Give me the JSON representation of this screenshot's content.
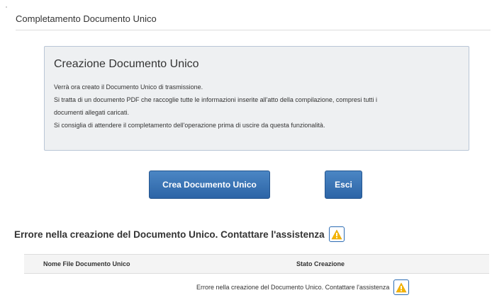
{
  "header": {
    "title": "Completamento Documento Unico"
  },
  "info_panel": {
    "title": "Creazione Documento Unico",
    "lines": [
      "Verrà ora creato il Documento Unico di trasmissione.",
      "Si tratta di un documento PDF che raccoglie tutte le informazioni inserite all'atto della compilazione, compresi tutti i",
      "documenti allegati caricati.",
      "Si consiglia di attendere il completamento dell'operazione prima di uscire da questa funzionalità."
    ]
  },
  "buttons": {
    "create_label": "Crea Documento Unico",
    "exit_label": "Esci"
  },
  "error": {
    "message": "Errore nella creazione del Documento Unico. Contattare l'assistenza",
    "icon": "warning-icon"
  },
  "table": {
    "columns": [
      "Nome File Documento Unico",
      "Stato Creazione"
    ],
    "rows": [
      {
        "file_name": "",
        "status": "Errore nella creazione del Documento Unico. Contattare l'assistenza"
      }
    ]
  },
  "colors": {
    "primary_button": "#2c64a6",
    "warning": "#f5b400",
    "panel_background": "#eef0f2"
  }
}
